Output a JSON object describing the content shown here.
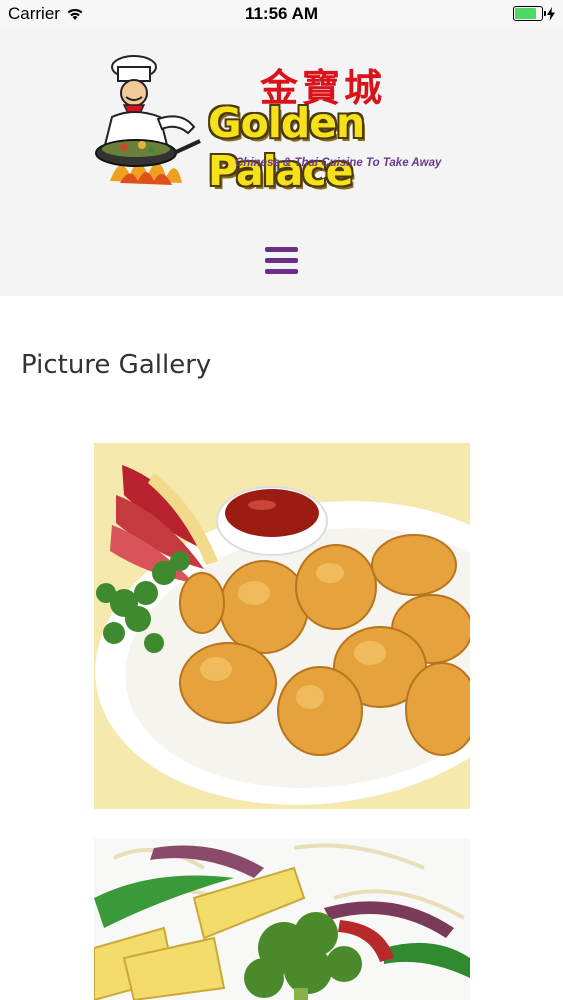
{
  "status_bar": {
    "carrier": "Carrier",
    "time": "11:56 AM",
    "battery_level": 0.8
  },
  "header": {
    "logo": {
      "chinese_name": "金寶城",
      "name": "Golden Palace",
      "tagline": "Chinese & Thai Cuisine To Take Away"
    },
    "menu_icon": "hamburger-icon"
  },
  "main": {
    "title": "Picture Gallery",
    "gallery": [
      {
        "image": "fried-battered-balls-with-sauce"
      },
      {
        "image": "stir-fried-vegetables"
      }
    ]
  },
  "colors": {
    "accent": "#6b2e86",
    "title": "#333333",
    "header_bg": "#f4f4f5",
    "logo_red": "#d8131a",
    "logo_yellow": "#f7e21a"
  }
}
